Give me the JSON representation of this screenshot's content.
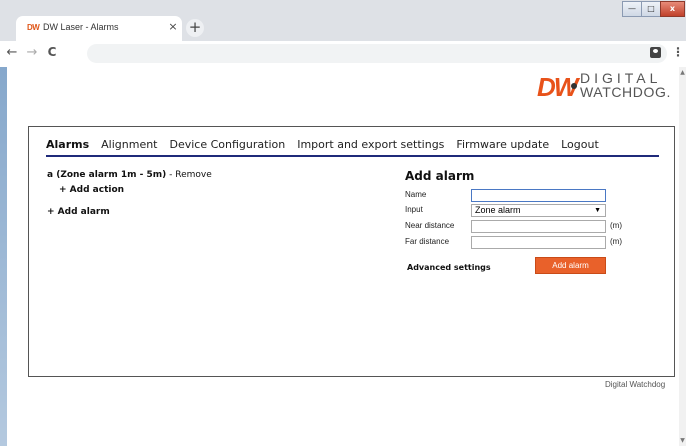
{
  "browser": {
    "tab_title": "DW Laser - Alarms",
    "favicon_text": "DW",
    "tab_close": "×",
    "new_tab": "+",
    "nav": {
      "back": "←",
      "forward": "→",
      "reload": "C"
    },
    "address": "",
    "menu_glyph": "⋮",
    "window_buttons": {
      "minimize": "—",
      "maximize": "□",
      "close": "x"
    }
  },
  "logo": {
    "mark": "DW",
    "line1": "DIGITAL",
    "line2": "WATCHDOG."
  },
  "menu": [
    {
      "label": "Alarms",
      "active": true
    },
    {
      "label": "Alignment"
    },
    {
      "label": "Device Configuration"
    },
    {
      "label": "Import and export settings"
    },
    {
      "label": "Firmware update"
    },
    {
      "label": "Logout"
    }
  ],
  "alarms": {
    "entry": "a (Zone alarm 1m - 5m)",
    "separator": " - ",
    "remove": "Remove",
    "add_action": "+ Add action",
    "add_alarm": "+ Add alarm"
  },
  "form": {
    "title": "Add alarm",
    "name_label": "Name",
    "name_value": "",
    "input_label": "Input",
    "input_value": "Zone alarm",
    "near_label": "Near distance",
    "near_value": "",
    "near_unit": "(m)",
    "far_label": "Far distance",
    "far_value": "",
    "far_unit": "(m)",
    "advanced": "Advanced settings",
    "submit": "Add alarm"
  },
  "footer": "Digital Watchdog",
  "colors": {
    "accent": "#e9612a",
    "menu_underline": "#1f2a7a"
  }
}
